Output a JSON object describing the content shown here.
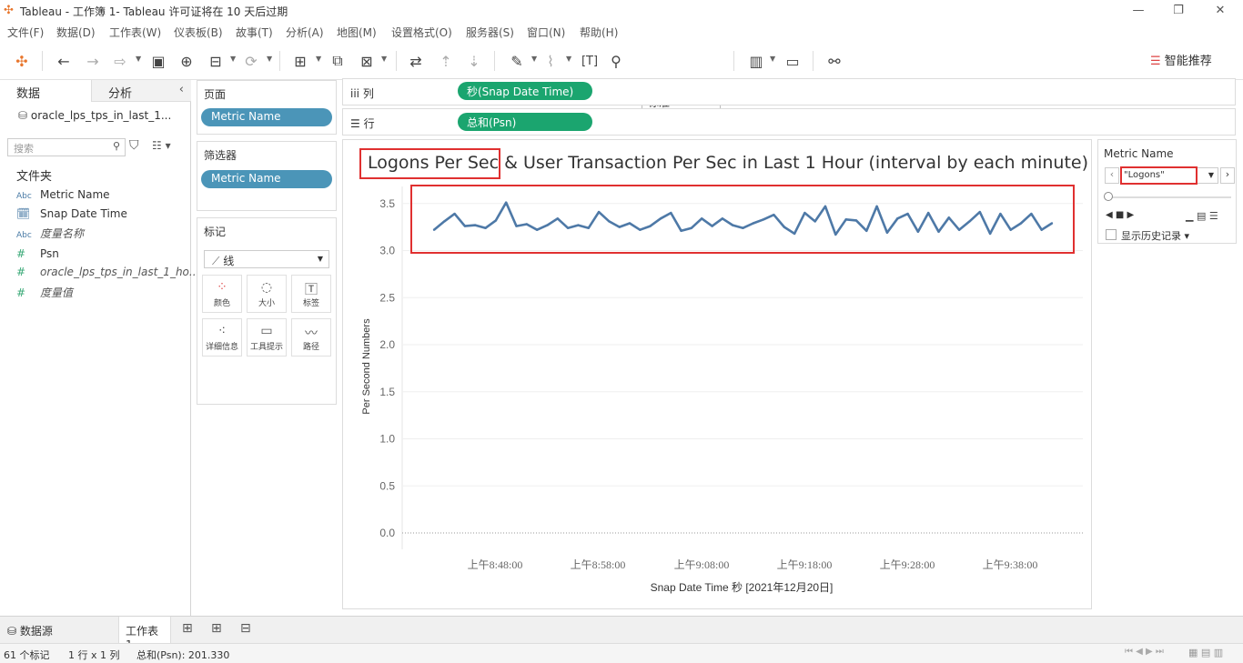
{
  "window": {
    "title": "Tableau - 工作簿 1- Tableau 许可证将在 10 天后过期"
  },
  "menu": [
    "文件(F)",
    "数据(D)",
    "工作表(W)",
    "仪表板(B)",
    "故事(T)",
    "分析(A)",
    "地图(M)",
    "设置格式(O)",
    "服务器(S)",
    "窗口(N)",
    "帮助(H)"
  ],
  "toolbar": {
    "fit": "标准",
    "smart": "智能推荐"
  },
  "datapane": {
    "tabs": [
      "数据",
      "分析"
    ],
    "datasource": "oracle_lps_tps_in_last_1...",
    "search_placeholder": "搜索",
    "folder": "文件夹",
    "fields": [
      {
        "type": "Abc",
        "name": "Metric Name",
        "italic": false
      },
      {
        "type": "cal",
        "name": "Snap Date Time",
        "italic": false
      },
      {
        "type": "Abc",
        "name": "度量名称",
        "italic": true
      },
      {
        "type": "#",
        "name": "Psn",
        "italic": false
      },
      {
        "type": "#",
        "name": "oracle_lps_tps_in_last_1_ho...",
        "italic": true
      },
      {
        "type": "#",
        "name": "度量值",
        "italic": true
      }
    ]
  },
  "shelves": {
    "pages_title": "页面",
    "pages_pill": "Metric Name",
    "filters_title": "筛选器",
    "filters_pill": "Metric Name",
    "marks_title": "标记",
    "mark_type": "线",
    "mark_buttons": [
      "颜色",
      "大小",
      "标签",
      "详细信息",
      "工具提示",
      "路径"
    ],
    "columns_label": "列",
    "columns_pill": "秒(Snap Date Time)",
    "rows_label": "行",
    "rows_pill": "总和(Psn)"
  },
  "chart_data": {
    "type": "line",
    "title": "Logons Per Sec & User Transaction Per Sec in Last 1 Hour (interval by each minute)",
    "xlabel": "Snap Date Time 秒 [2021年12月20日]",
    "ylabel": "Per Second Numbers",
    "ylim": [
      0,
      3.6
    ],
    "yticks": [
      "0.0",
      "0.5",
      "1.0",
      "1.5",
      "2.0",
      "2.5",
      "3.0",
      "3.5"
    ],
    "xticks": [
      "上午8:48:00",
      "上午8:58:00",
      "上午9:08:00",
      "上午9:18:00",
      "上午9:28:00",
      "上午9:38:00"
    ],
    "color": "#4e79a7",
    "series": [
      {
        "values": [
          3.22,
          3.31,
          3.39,
          3.26,
          3.27,
          3.24,
          3.32,
          3.51,
          3.26,
          3.28,
          3.22,
          3.27,
          3.34,
          3.24,
          3.27,
          3.24,
          3.41,
          3.31,
          3.25,
          3.29,
          3.22,
          3.26,
          3.34,
          3.4,
          3.21,
          3.24,
          3.34,
          3.26,
          3.34,
          3.27,
          3.24,
          3.29,
          3.33,
          3.38,
          3.25,
          3.18,
          3.4,
          3.31,
          3.47,
          3.17,
          3.33,
          3.32,
          3.21,
          3.47,
          3.19,
          3.34,
          3.39,
          3.2,
          3.4,
          3.2,
          3.35,
          3.22,
          3.31,
          3.41,
          3.18,
          3.39,
          3.22,
          3.29,
          3.39,
          3.22,
          3.29
        ]
      }
    ]
  },
  "filter_card": {
    "title": "Metric Name",
    "value": "\"Logons\"",
    "history": "显示历史记录"
  },
  "sheets": {
    "datasource_tab": "数据源",
    "sheet1": "工作表 1"
  },
  "status": {
    "marks": "61 个标记",
    "dims": "1 行 x 1 列",
    "sum": "总和(Psn): 201.330"
  }
}
